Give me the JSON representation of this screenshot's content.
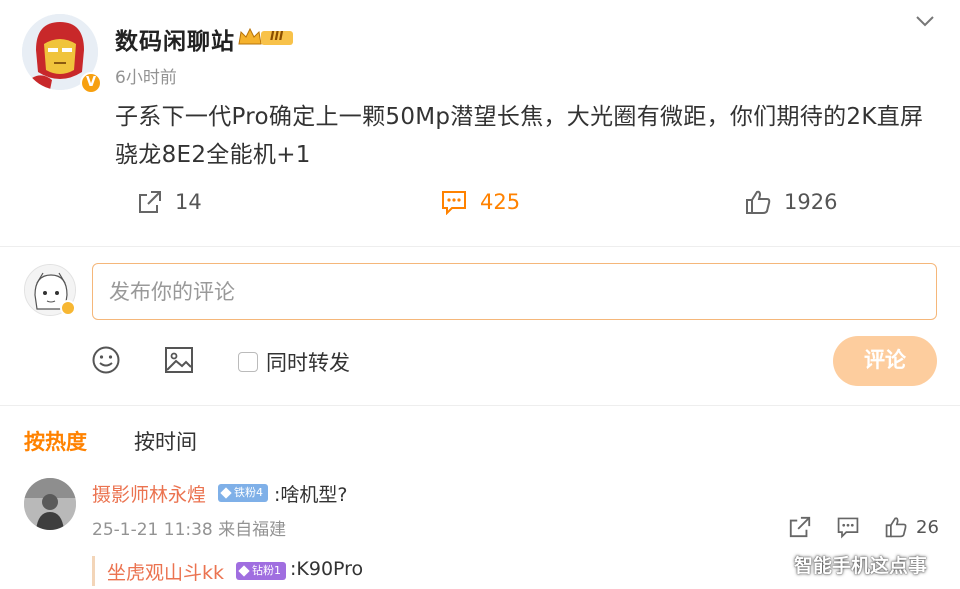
{
  "post": {
    "author": "数码闲聊站",
    "level_badge": "III",
    "time": "6小时前",
    "text": "子系下一代Pro确定上一颗50Mp潜望长焦，大光圈有微距，你们期待的2K直屏骁龙8E2全能机+1",
    "verified_mark": "V",
    "actions": {
      "reposts": "14",
      "comments": "425",
      "likes": "1926"
    }
  },
  "composer": {
    "placeholder": "发布你的评论",
    "repost_label": "同时转发",
    "submit_label": "评论"
  },
  "sort_tabs": {
    "hot": "按热度",
    "time": "按时间"
  },
  "comments": [
    {
      "user": "摄影师林永煌",
      "badge": "铁粉4",
      "text": ":啥机型?",
      "meta": "25-1-21 11:38 来自福建",
      "likes": "26",
      "reply": {
        "user": "坐虎观山斗kk",
        "badge": "钻粉1",
        "text": ":K90Pro"
      }
    }
  ],
  "watermark": "智能手机这点事",
  "colors": {
    "accent": "#ff8200",
    "username": "#eb7350",
    "submit_disabled": "#fdcd9e",
    "input_border": "#f5b77a"
  }
}
